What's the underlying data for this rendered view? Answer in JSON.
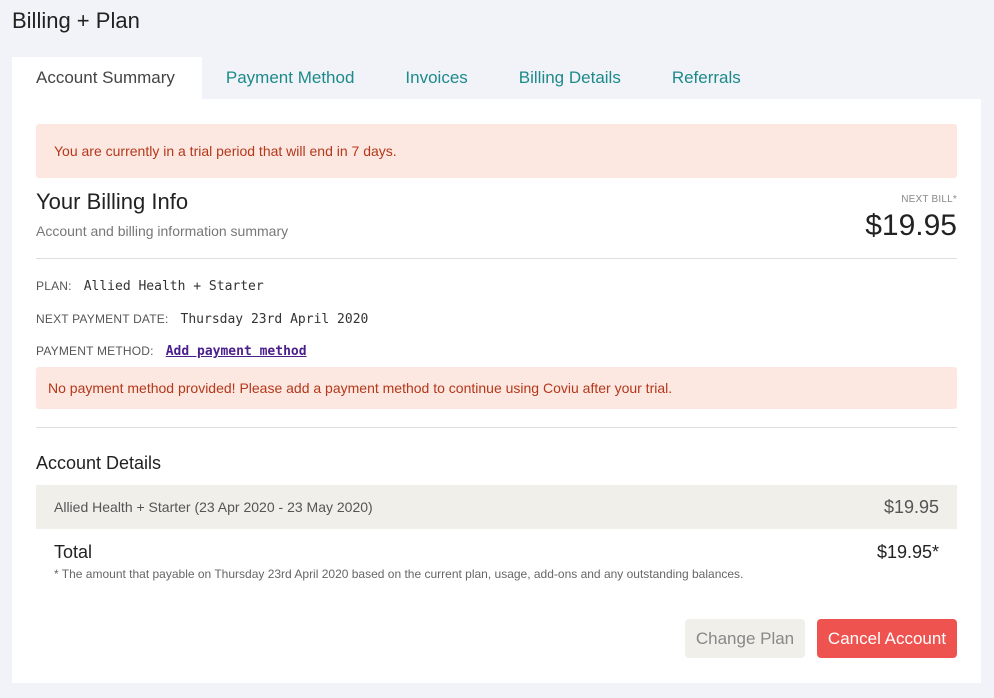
{
  "page": {
    "title": "Billing + Plan"
  },
  "tabs": [
    {
      "label": "Account Summary",
      "active": true
    },
    {
      "label": "Payment Method",
      "active": false
    },
    {
      "label": "Invoices",
      "active": false
    },
    {
      "label": "Billing Details",
      "active": false
    },
    {
      "label": "Referrals",
      "active": false
    }
  ],
  "trial_alert": "You are currently in a trial period that will end in 7 days.",
  "billing_info": {
    "title": "Your Billing Info",
    "subtitle": "Account and billing information summary",
    "next_bill_label": "NEXT BILL*",
    "next_bill_amount": "$19.95",
    "plan_label": "PLAN:",
    "plan_value": "Allied Health + Starter",
    "next_payment_label": "NEXT PAYMENT DATE:",
    "next_payment_value": "Thursday 23rd April 2020",
    "payment_method_label": "PAYMENT METHOD:",
    "payment_method_link": "Add payment method"
  },
  "no_payment_alert": "No payment method provided! Please add a payment method to continue using Coviu after your trial.",
  "account_details": {
    "title": "Account Details",
    "line_item": {
      "description": "Allied Health + Starter (23 Apr 2020 - 23 May 2020)",
      "amount": "$19.95"
    },
    "total_label": "Total",
    "total_amount": "$19.95*",
    "total_note": "* The amount that payable on Thursday 23rd April 2020 based on the current plan, usage, add-ons and any outstanding balances."
  },
  "actions": {
    "change_plan": "Change Plan",
    "cancel_account": "Cancel Account"
  },
  "colors": {
    "accent": "#1d8a8a",
    "danger": "#ef5350",
    "alert_bg": "#fde7e1",
    "alert_text": "#b4381a"
  }
}
